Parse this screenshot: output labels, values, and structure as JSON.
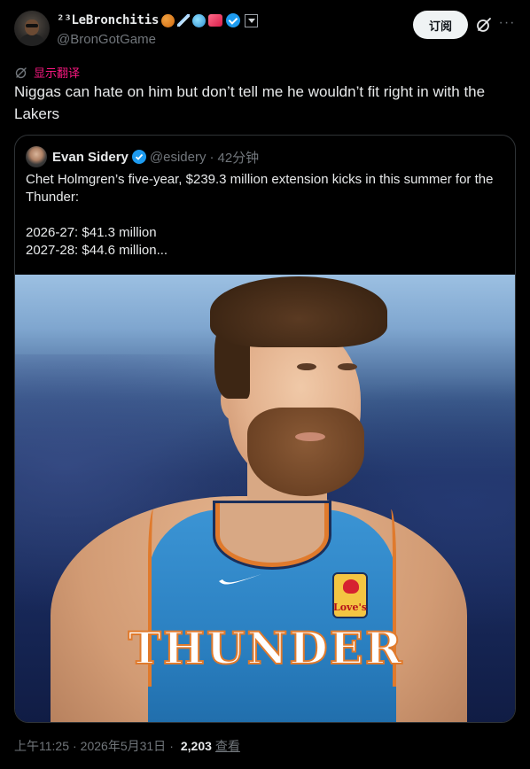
{
  "author": {
    "display_name": "²³LeBronchitis",
    "handle": "@BronGotGame"
  },
  "header": {
    "subscribe_label": "订阅",
    "more_icon": "more-icon",
    "grok_icon": "grok-icon"
  },
  "translate": {
    "label": "显示翻译"
  },
  "tweet": {
    "text": "Niggas can hate on him but don’t tell me he wouldn’t fit right in with the Lakers"
  },
  "quote": {
    "name": "Evan Sidery",
    "handle": "@esidery",
    "separator": "·",
    "time": "42分钟",
    "lines": [
      "Chet Holmgren’s five-year, $239.3 million extension kicks in this summer for the Thunder:",
      "",
      "2026-27: $41.3 million",
      "2027-28: $44.6 million..."
    ],
    "image": {
      "jersey_text": "THUNDER",
      "patch_text": "Love's"
    }
  },
  "meta": {
    "time": "上午11:25",
    "sep1": "·",
    "date": "2026年5月31日",
    "sep2": "·",
    "views_count": "2,203",
    "views_label": "查看"
  },
  "colors": {
    "background": "#000000",
    "text": "#e7e9ea",
    "muted": "#71767b",
    "translate_accent": "#f91880",
    "verified": "#1d9bf0"
  }
}
